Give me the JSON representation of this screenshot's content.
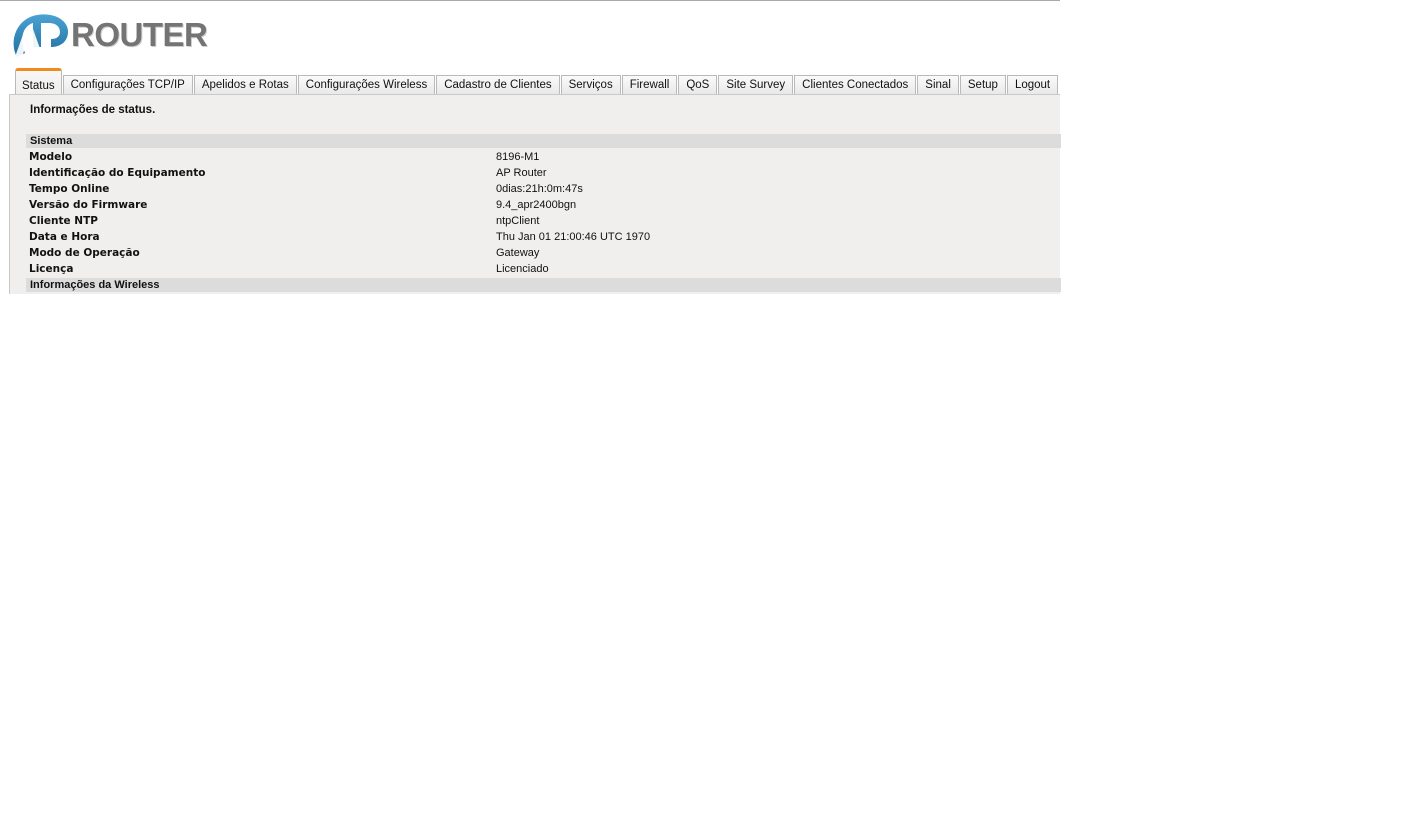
{
  "logo": {
    "text": "ROUTER",
    "mark": "AP",
    "colors": {
      "mark": "#2f86b8",
      "text": "#747474"
    }
  },
  "tabs": [
    {
      "label": "Status",
      "active": true
    },
    {
      "label": "Configurações TCP/IP"
    },
    {
      "label": "Apelidos e Rotas"
    },
    {
      "label": "Configurações Wireless"
    },
    {
      "label": "Cadastro de Clientes"
    },
    {
      "label": "Serviços"
    },
    {
      "label": "Firewall"
    },
    {
      "label": "QoS"
    },
    {
      "label": "Site Survey"
    },
    {
      "label": "Clientes Conectados"
    },
    {
      "label": "Sinal"
    },
    {
      "label": "Setup"
    },
    {
      "label": "Logout"
    }
  ],
  "panel": {
    "title": "Informações de status.",
    "system_section": "Sistema",
    "rows": [
      {
        "key": "Modelo",
        "value": "8196-M1"
      },
      {
        "key": "Identificação do Equipamento",
        "value": "AP Router"
      },
      {
        "key": "Tempo Online",
        "value": "0dias:21h:0m:47s"
      },
      {
        "key": "Versão do Firmware",
        "value": "9.4_apr2400bgn"
      },
      {
        "key": "Cliente NTP",
        "value": "ntpClient"
      },
      {
        "key": "Data e Hora",
        "value": "Thu Jan 01 21:00:46 UTC 1970"
      },
      {
        "key": "Modo de Operação",
        "value": "Gateway"
      },
      {
        "key": "Licença",
        "value": "Licenciado"
      }
    ],
    "wireless_section": "Informações da Wireless"
  },
  "colors": {
    "active_tab_accent": "#f08a1c",
    "section_bar": "#dcdcdc",
    "panel_bg": "#f1efee"
  }
}
